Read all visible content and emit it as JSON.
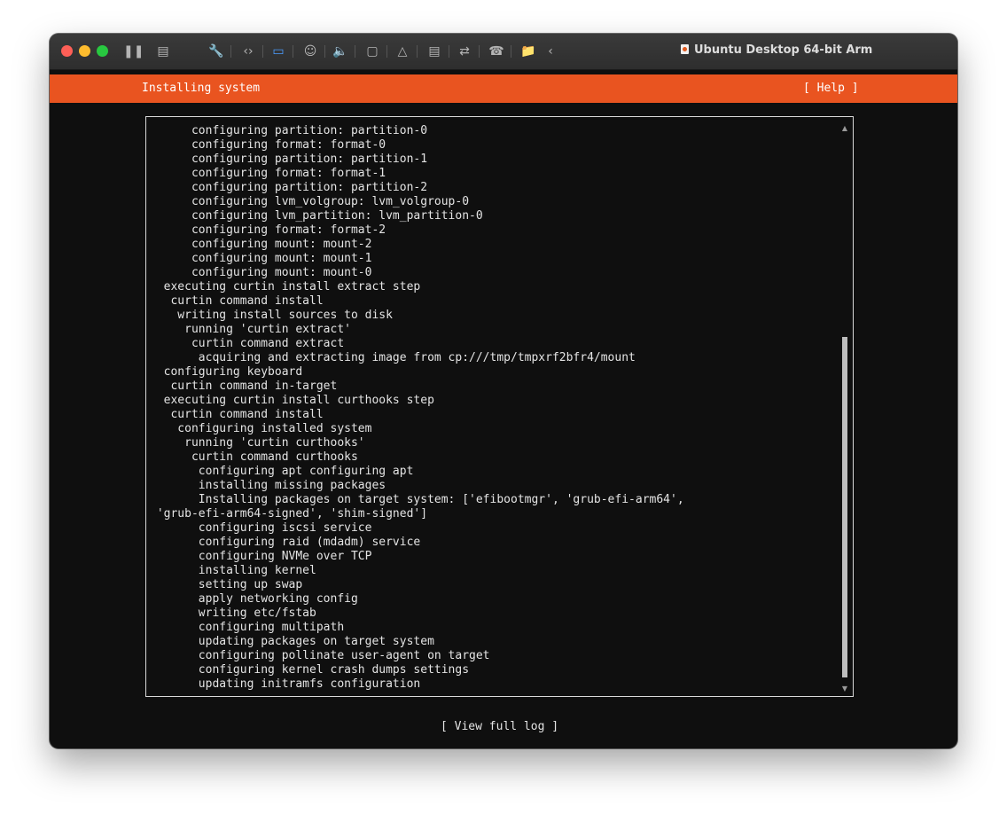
{
  "window": {
    "title": "Ubuntu Desktop 64-bit Arm",
    "toolbar_icons": [
      "pause-icon",
      "snapshot-icon",
      "wrench-icon",
      "code-icon",
      "drive-icon",
      "user-icon",
      "speaker-icon",
      "camera-icon",
      "mouse-icon",
      "hdd-icon",
      "usb-icon",
      "phone-icon",
      "folder-icon",
      "chevron-left-icon"
    ]
  },
  "installer": {
    "header_title": "Installing system",
    "help_label": "[ Help ]",
    "view_log_label": "[ View full log ]",
    "accent_color": "#e95420",
    "log_lines": [
      "      configuring partition: partition-0",
      "      configuring format: format-0",
      "      configuring partition: partition-1",
      "      configuring format: format-1",
      "      configuring partition: partition-2",
      "      configuring lvm_volgroup: lvm_volgroup-0",
      "      configuring lvm_partition: lvm_partition-0",
      "      configuring format: format-2",
      "      configuring mount: mount-2",
      "      configuring mount: mount-1",
      "      configuring mount: mount-0",
      "  executing curtin install extract step",
      "   curtin command install",
      "    writing install sources to disk",
      "     running 'curtin extract'",
      "      curtin command extract",
      "       acquiring and extracting image from cp:///tmp/tmpxrf2bfr4/mount",
      "  configuring keyboard",
      "   curtin command in-target",
      "  executing curtin install curthooks step",
      "   curtin command install",
      "    configuring installed system",
      "     running 'curtin curthooks'",
      "      curtin command curthooks",
      "       configuring apt configuring apt",
      "       installing missing packages",
      "       Installing packages on target system: ['efibootmgr', 'grub-efi-arm64',",
      " 'grub-efi-arm64-signed', 'shim-signed']",
      "       configuring iscsi service",
      "       configuring raid (mdadm) service",
      "       configuring NVMe over TCP",
      "       installing kernel",
      "       setting up swap",
      "       apply networking config",
      "       writing etc/fstab",
      "       configuring multipath",
      "       updating packages on target system",
      "       configuring pollinate user-agent on target",
      "       configuring kernel crash dumps settings",
      "       updating initramfs configuration"
    ]
  }
}
